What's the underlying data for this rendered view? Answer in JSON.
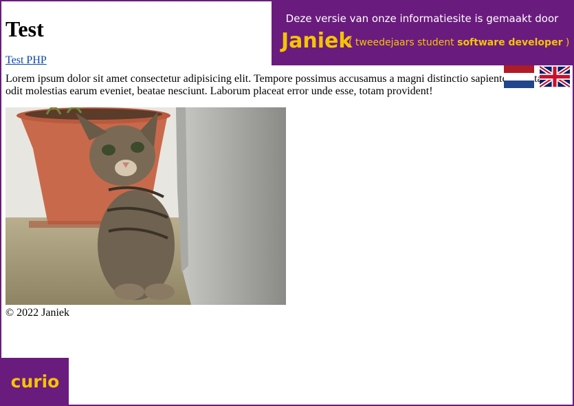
{
  "page": {
    "title": "Test",
    "link_label": "Test PHP",
    "paragraph": "Lorem ipsum dolor sit amet consectetur adipisicing elit. Tempore possimus accusamus a magni distinctio sapiente, ab vitae, odit molestias earum eveniet, beatae nesciunt. Laborum placeat error unde esse, totam provident!",
    "footer": "© 2022 Janiek"
  },
  "banner": {
    "line1": "Deze versie van onze informatiesite is gemaakt door",
    "name": "Janiek",
    "role_prefix": "( tweedejaars student ",
    "role_bold": "software developer",
    "role_suffix": " )"
  },
  "flags": [
    {
      "name": "dutch-flag-icon",
      "language": "nl"
    },
    {
      "name": "uk-flag-icon",
      "language": "en"
    }
  ],
  "logo": {
    "text": "curio"
  },
  "colors": {
    "purple": "#6a1b7e",
    "yellow": "#f5c400",
    "link": "#0645ad"
  }
}
